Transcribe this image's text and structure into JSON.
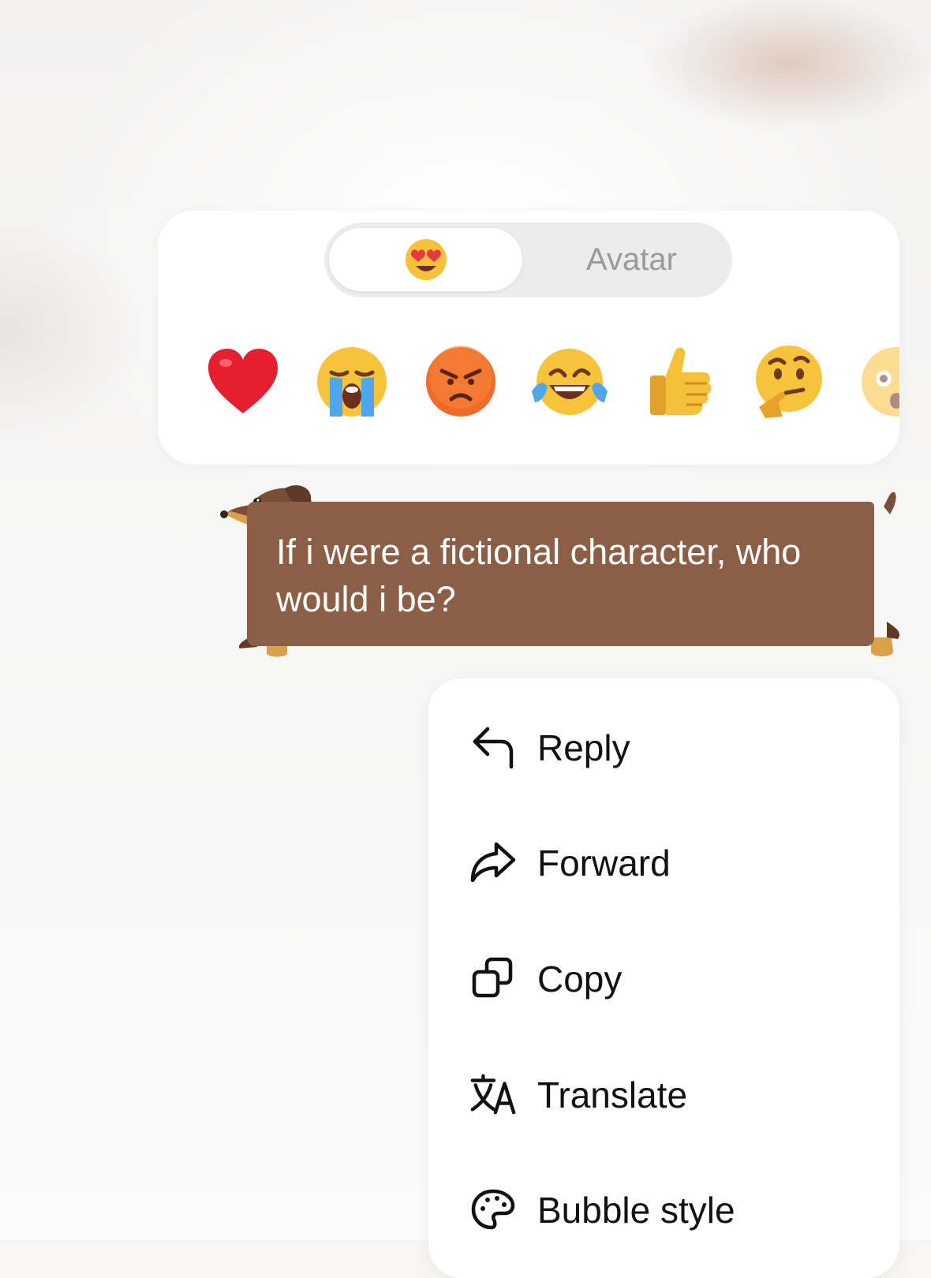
{
  "reaction_panel": {
    "segments": {
      "emoji_tab_icon": "heart-eyes-emoji",
      "avatar_label": "Avatar"
    },
    "emojis": [
      {
        "name": "red-heart"
      },
      {
        "name": "loudly-crying-face"
      },
      {
        "name": "angry-face"
      },
      {
        "name": "face-with-tears-of-joy"
      },
      {
        "name": "thumbs-up"
      },
      {
        "name": "thinking-face"
      },
      {
        "name": "astonished-face"
      }
    ]
  },
  "message": {
    "text": "If i were a fictional character, who would i be?",
    "bubble_color": "#8b5e45"
  },
  "menu": {
    "items": [
      {
        "label": "Reply",
        "icon": "reply-icon"
      },
      {
        "label": "Forward",
        "icon": "forward-icon"
      },
      {
        "label": "Copy",
        "icon": "copy-icon"
      },
      {
        "label": "Translate",
        "icon": "translate-icon"
      },
      {
        "label": "Bubble style",
        "icon": "palette-icon"
      }
    ]
  }
}
